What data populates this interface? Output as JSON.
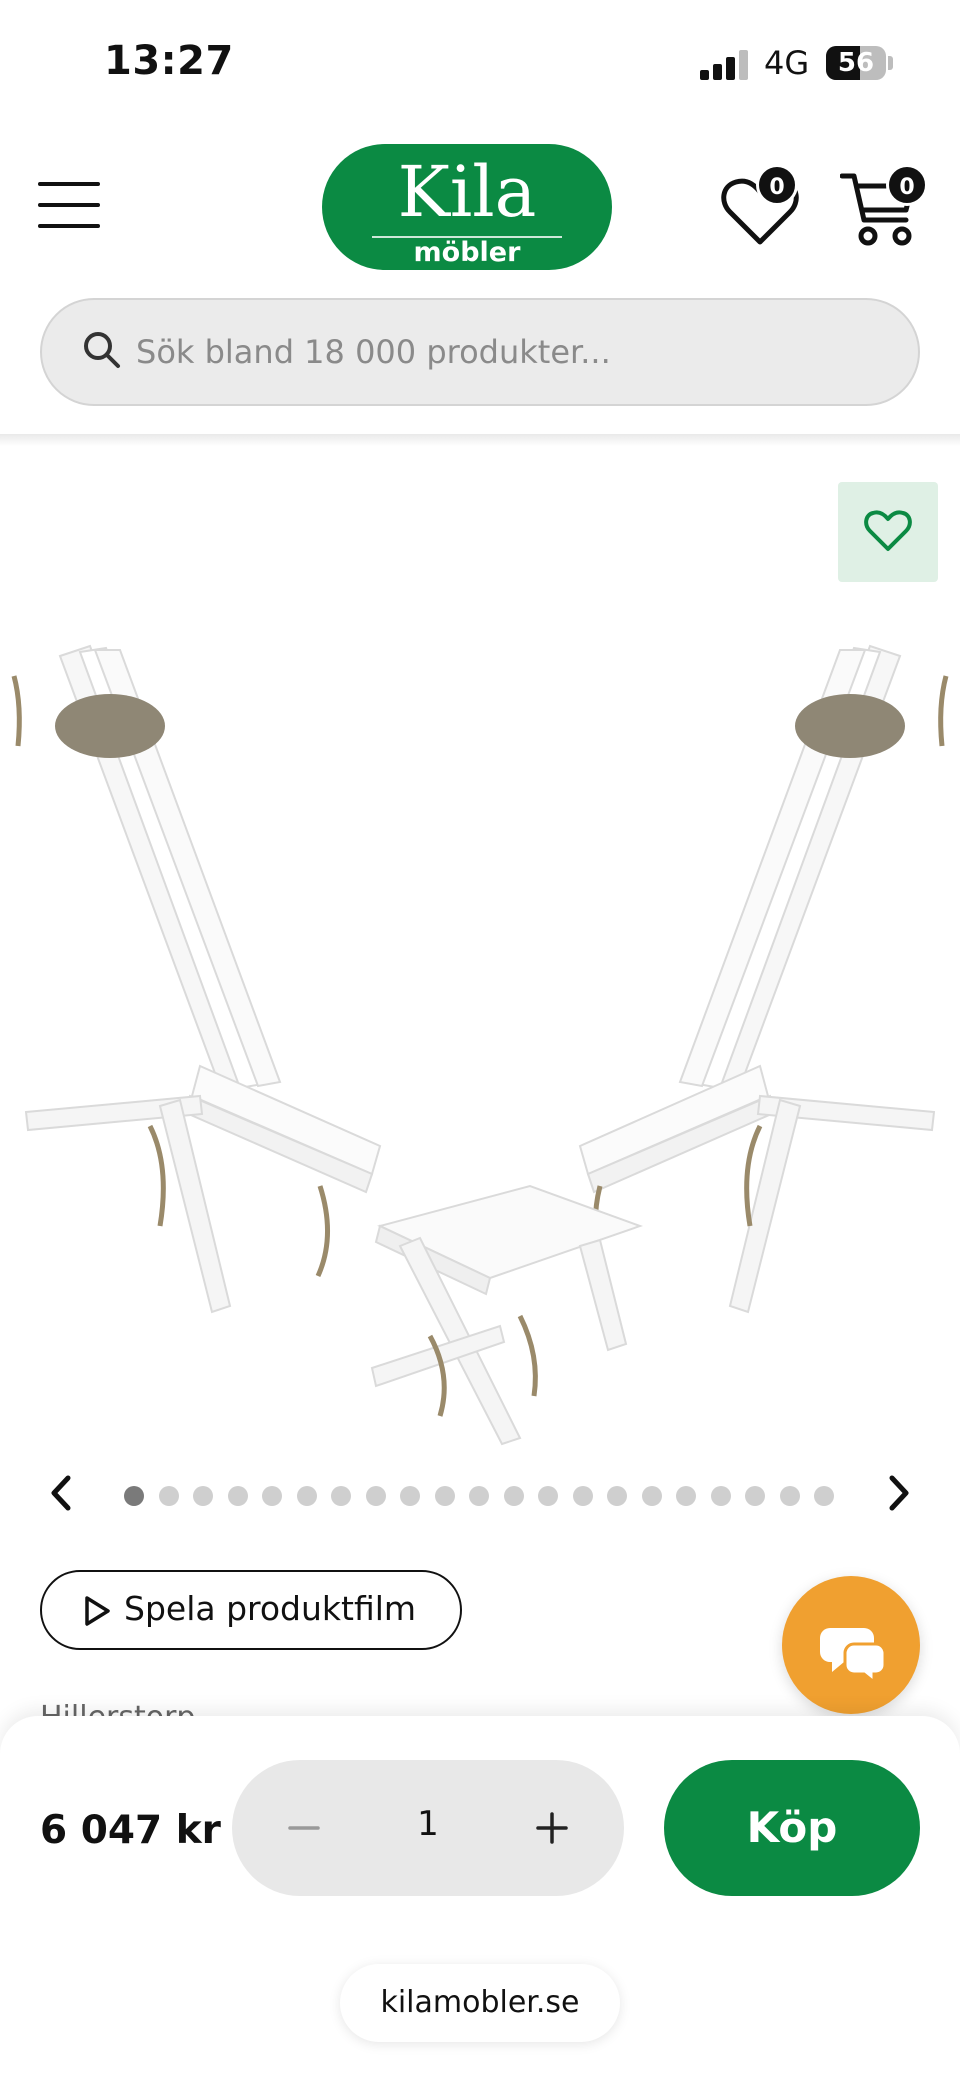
{
  "status_bar": {
    "time": "13:27",
    "network": "4G",
    "battery": "56",
    "battery_level": 0.56
  },
  "header": {
    "logo_main": "Kila",
    "logo_sub": "möbler",
    "wishlist_count": "0",
    "cart_count": "0",
    "brand_color": "#0b8a43"
  },
  "search": {
    "placeholder": "Sök bland 18 000 produkter..."
  },
  "gallery": {
    "image_count": 21,
    "active_index": 0,
    "favorite_bg": "#dff0e5"
  },
  "product": {
    "video_label": "Spela produktfilm",
    "brand_peek": "Hillerstorp"
  },
  "purchase": {
    "price": "6 047 kr",
    "quantity": "1",
    "buy_label": "Köp"
  },
  "browser": {
    "url": "kilamobler.se"
  },
  "colors": {
    "accent_green": "#0b8a43",
    "chat_orange": "#f0a030"
  }
}
